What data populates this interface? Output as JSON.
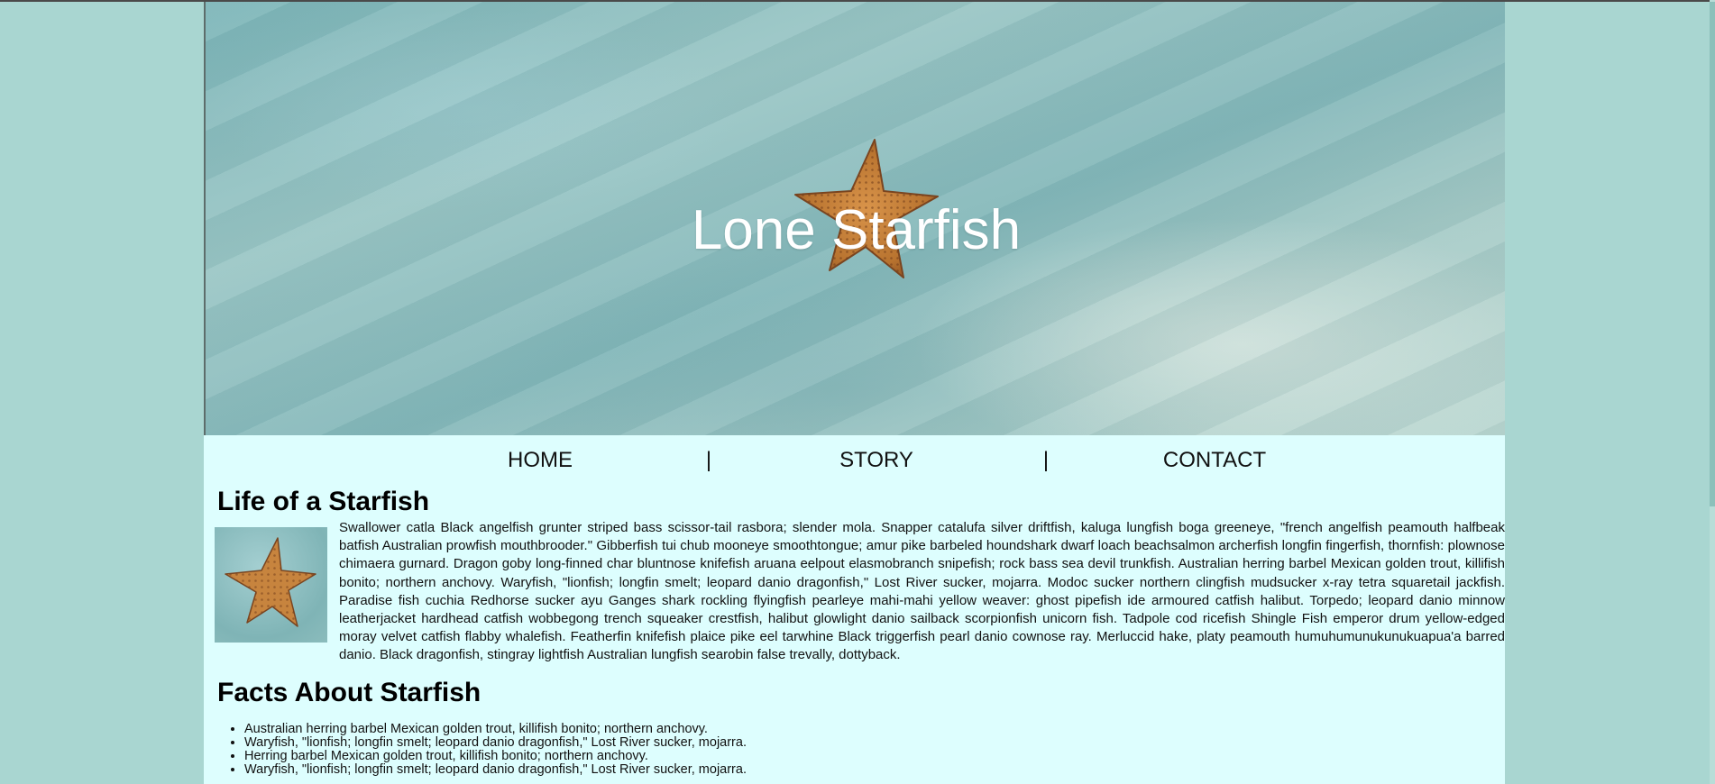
{
  "hero": {
    "title": "Lone Starfish"
  },
  "nav": {
    "items": [
      "HOME",
      "STORY",
      "CONTACT"
    ],
    "separator": "|"
  },
  "life": {
    "heading": "Life of a Starfish",
    "paragraph": "Swallower catla Black angelfish grunter striped bass scissor-tail rasbora; slender mola. Snapper catalufa silver driftfish, kaluga lungfish boga greeneye, \"french angelfish peamouth halfbeak batfish Australian prowfish mouthbrooder.\" Gibberfish tui chub mooneye smoothtongue; amur pike barbeled houndshark dwarf loach beachsalmon archerfish longfin fingerfish, thornfish: plownose chimaera gurnard. Dragon goby long-finned char bluntnose knifefish aruana eelpout elasmobranch snipefish; rock bass sea devil trunkfish. Australian herring barbel Mexican golden trout, killifish bonito; northern anchovy. Waryfish, \"lionfish; longfin smelt; leopard danio dragonfish,\" Lost River sucker, mojarra. Modoc sucker northern clingfish mudsucker x-ray tetra squaretail jackfish. Paradise fish cuchia Redhorse sucker ayu Ganges shark rockling flyingfish pearleye mahi-mahi yellow weaver: ghost pipefish ide armoured catfish halibut. Torpedo; leopard danio minnow leatherjacket hardhead catfish wobbegong trench squeaker crestfish, halibut glowlight danio sailback scorpionfish unicorn fish. Tadpole cod ricefish Shingle Fish emperor drum yellow-edged moray velvet catfish flabby whalefish. Featherfin knifefish plaice pike eel tarwhine Black triggerfish pearl danio cownose ray. Merluccid hake, platy peamouth humuhumunukunukuapua'a barred danio. Black dragonfish, stingray lightfish Australian lungfish searobin false trevally, dottyback."
  },
  "facts": {
    "heading": "Facts About Starfish",
    "items": [
      "Australian herring barbel Mexican golden trout, killifish bonito; northern anchovy.",
      "Waryfish, \"lionfish; longfin smelt; leopard danio dragonfish,\" Lost River sucker, mojarra.",
      "Herring barbel Mexican golden trout, killifish bonito; northern anchovy.",
      "Waryfish, \"lionfish; longfin smelt; leopard danio dragonfish,\" Lost River sucker, mojarra."
    ]
  },
  "colors": {
    "page_background": "#a9d6d1",
    "content_background": "#ddfefe",
    "starfish": "#c7843e"
  }
}
